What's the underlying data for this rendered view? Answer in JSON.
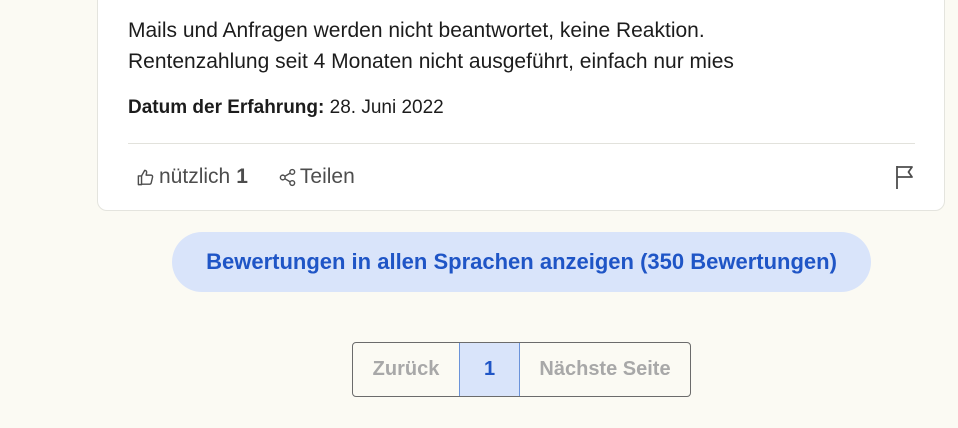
{
  "review": {
    "text_lines": [
      "Mails und Anfragen werden nicht beantwortet, keine Reaktion.",
      "Rentenzahlung seit 4 Monaten nicht ausgeführt, einfach nur mies"
    ],
    "date_label": "Datum der Erfahrung:",
    "date_value": " 28. Juni 2022",
    "useful_label": "nützlich",
    "useful_count": "1",
    "share_label": "Teilen"
  },
  "show_all_languages_button": "Bewertungen in allen Sprachen anzeigen (350 Bewertungen)",
  "pagination": {
    "prev": "Zurück",
    "current": "1",
    "next": "Nächste Seite"
  },
  "colors": {
    "background": "#fbfaf3",
    "accent": "#1f55c6",
    "accent_light": "#d9e4fa"
  },
  "icons": [
    "thumbs-up-icon",
    "share-icon",
    "flag-icon"
  ]
}
